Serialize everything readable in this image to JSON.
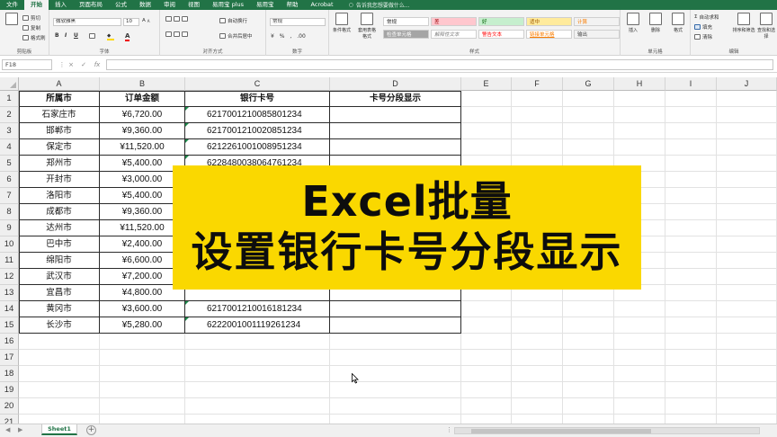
{
  "menu": {
    "items": [
      "文件",
      "开始",
      "插入",
      "页面布局",
      "公式",
      "数据",
      "审阅",
      "视图",
      "易用宝 plus",
      "易用宝",
      "帮助",
      "Acrobat"
    ],
    "active_index": 1,
    "search_placeholder": "告诉我您想要做什么..."
  },
  "ribbon": {
    "clipboard": {
      "cut": "剪切",
      "copy": "复制",
      "format_painter": "格式刷",
      "label": "剪贴板"
    },
    "font": {
      "family": "微软雅黑",
      "size": "10",
      "bold": "B",
      "italic": "I",
      "underline": "U",
      "label": "字体"
    },
    "alignment": {
      "wrap": "自动换行",
      "merge": "合并后居中",
      "label": "对齐方式"
    },
    "number": {
      "format": "常规",
      "label": "数字"
    },
    "styles": {
      "conditional": "条件格式",
      "table_format": "套用表格格式",
      "cells": [
        {
          "text": "常规",
          "bg": "#ffffff",
          "color": "#222222"
        },
        {
          "text": "差",
          "bg": "#ffc7ce",
          "color": "#9c0006"
        },
        {
          "text": "好",
          "bg": "#c6efce",
          "color": "#006100"
        },
        {
          "text": "适中",
          "bg": "#ffeb9c",
          "color": "#9c5700"
        },
        {
          "text": "计算",
          "bg": "#f2f2f2",
          "color": "#fa7d00"
        },
        {
          "text": "检查单元格",
          "bg": "#a5a5a5",
          "color": "#ffffff"
        },
        {
          "text": "解释性文本",
          "bg": "#ffffff",
          "color": "#7f7f7f"
        },
        {
          "text": "警告文本",
          "bg": "#ffffff",
          "color": "#ff0000"
        },
        {
          "text": "链接单元格",
          "bg": "#ffffff",
          "color": "#fa7d00"
        },
        {
          "text": "输出",
          "bg": "#f2f2f2",
          "color": "#3f3f3f"
        }
      ],
      "label": "样式"
    },
    "cells_group": {
      "insert": "插入",
      "delete": "删除",
      "format": "格式",
      "label": "单元格"
    },
    "editing": {
      "autosum": "自动求和",
      "fill": "填充",
      "clear": "清除",
      "sort": "排序和筛选",
      "find": "查找和选择",
      "label": "编辑"
    }
  },
  "formula_bar": {
    "name_box": "F18",
    "cancel": "×",
    "enter": "✓",
    "fx": "fx",
    "value": ""
  },
  "sheet": {
    "columns": [
      "A",
      "B",
      "C",
      "D",
      "E",
      "F",
      "G",
      "H",
      "I",
      "J"
    ],
    "row_numbers": [
      "1",
      "2",
      "3",
      "4",
      "5",
      "6",
      "7",
      "8",
      "9",
      "10",
      "11",
      "12",
      "13",
      "14",
      "15",
      "16",
      "17",
      "18",
      "19",
      "20",
      "21"
    ],
    "headers": [
      "所属市",
      "订单金额",
      "银行卡号",
      "卡号分段显示"
    ],
    "rows": [
      {
        "city": "石家庄市",
        "amount": "¥6,720.00",
        "card": "6217001210085801234",
        "split": ""
      },
      {
        "city": "邯郸市",
        "amount": "¥9,360.00",
        "card": "6217001210020851234",
        "split": ""
      },
      {
        "city": "保定市",
        "amount": "¥11,520.00",
        "card": "6212261001008951234",
        "split": ""
      },
      {
        "city": "郑州市",
        "amount": "¥5,400.00",
        "card": "6228480038064761234",
        "split": ""
      },
      {
        "city": "开封市",
        "amount": "¥3,000.00",
        "card": "",
        "split": ""
      },
      {
        "city": "洛阳市",
        "amount": "¥5,400.00",
        "card": "",
        "split": ""
      },
      {
        "city": "成都市",
        "amount": "¥9,360.00",
        "card": "",
        "split": ""
      },
      {
        "city": "达州市",
        "amount": "¥11,520.00",
        "card": "",
        "split": ""
      },
      {
        "city": "巴中市",
        "amount": "¥2,400.00",
        "card": "",
        "split": ""
      },
      {
        "city": "绵阳市",
        "amount": "¥6,600.00",
        "card": "",
        "split": ""
      },
      {
        "city": "武汉市",
        "amount": "¥7,200.00",
        "card": "",
        "split": ""
      },
      {
        "city": "宜昌市",
        "amount": "¥4,800.00",
        "card": "",
        "split": ""
      },
      {
        "city": "黄冈市",
        "amount": "¥3,600.00",
        "card": "6217001210016181234",
        "split": ""
      },
      {
        "city": "长沙市",
        "amount": "¥5,280.00",
        "card": "6222001001119261234",
        "split": ""
      }
    ]
  },
  "banner": {
    "line1": "Excel批量",
    "line2": "设置银行卡号分段显示"
  },
  "tabs": {
    "sheet_name": "Sheet1",
    "add": "+"
  }
}
